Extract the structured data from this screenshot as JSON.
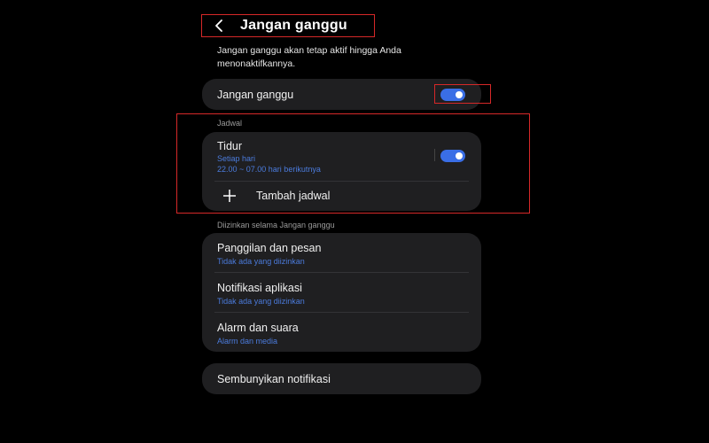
{
  "header": {
    "title": "Jangan ganggu"
  },
  "description": "Jangan ganggu akan tetap aktif hingga Anda menonaktifkannya.",
  "main_toggle": {
    "label": "Jangan ganggu",
    "state": "on"
  },
  "schedule": {
    "section_label": "Jadwal",
    "items": [
      {
        "title": "Tidur",
        "repeat": "Setiap hari",
        "time": "22.00 ~ 07.00 hari berikutnya",
        "state": "on"
      }
    ],
    "add_label": "Tambah jadwal"
  },
  "allowed": {
    "section_label": "Diizinkan selama Jangan ganggu",
    "items": [
      {
        "title": "Panggilan dan pesan",
        "sub": "Tidak ada yang diizinkan"
      },
      {
        "title": "Notifikasi aplikasi",
        "sub": "Tidak ada yang diizinkan"
      },
      {
        "title": "Alarm dan suara",
        "sub": "Alarm dan media"
      }
    ]
  },
  "hide_notifications": {
    "label": "Sembunyikan notifikasi"
  },
  "colors": {
    "background": "#000000",
    "card": "#1f1f21",
    "accent": "#3a6ee6",
    "sub_text": "#4b7bdc",
    "annotation": "#d62828"
  }
}
